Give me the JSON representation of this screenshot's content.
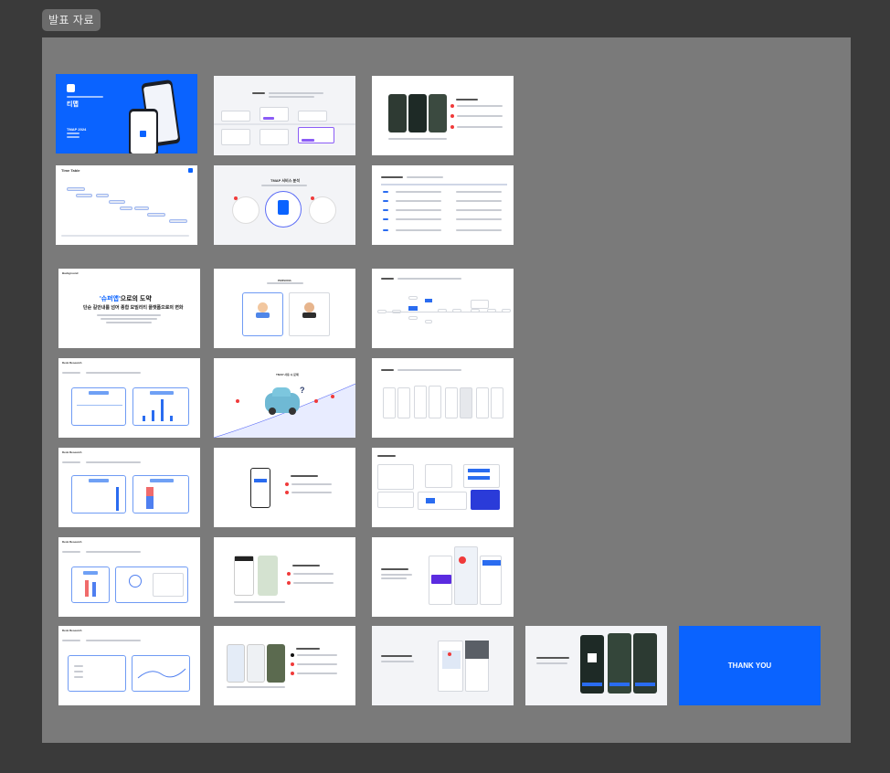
{
  "frame": {
    "label": "발표 자료"
  },
  "slides": {
    "s1": {
      "app_name": "티맵",
      "caption": "TMAP 2024"
    },
    "s4": {
      "title": "Time Table"
    },
    "s5": {
      "title": "TMAP 서비스 분석"
    },
    "s7": {
      "heading_highlight": "'슈퍼앱'",
      "heading_rest": "으로의 도약",
      "subtitle": "단순 길안내를 넘어 종합 모빌리티 플랫폼으로의 변화",
      "tag": "Background"
    },
    "s8": {
      "title": "PERSONA"
    },
    "s10": {
      "tag": "Desk Research"
    },
    "s11": {
      "title": "TMAP 사용 시 문제"
    },
    "s13": {
      "tag": "Desk Research"
    },
    "s16": {
      "tag": "Desk Research"
    },
    "s19": {
      "tag": "Desk Research"
    },
    "s23": {
      "label": "THANK YOU"
    }
  },
  "colors": {
    "canvas": "#3a3a3a",
    "frame": "#7a7a7a",
    "accent": "#0a63ff",
    "highlight_dot": "#f03a3a"
  }
}
